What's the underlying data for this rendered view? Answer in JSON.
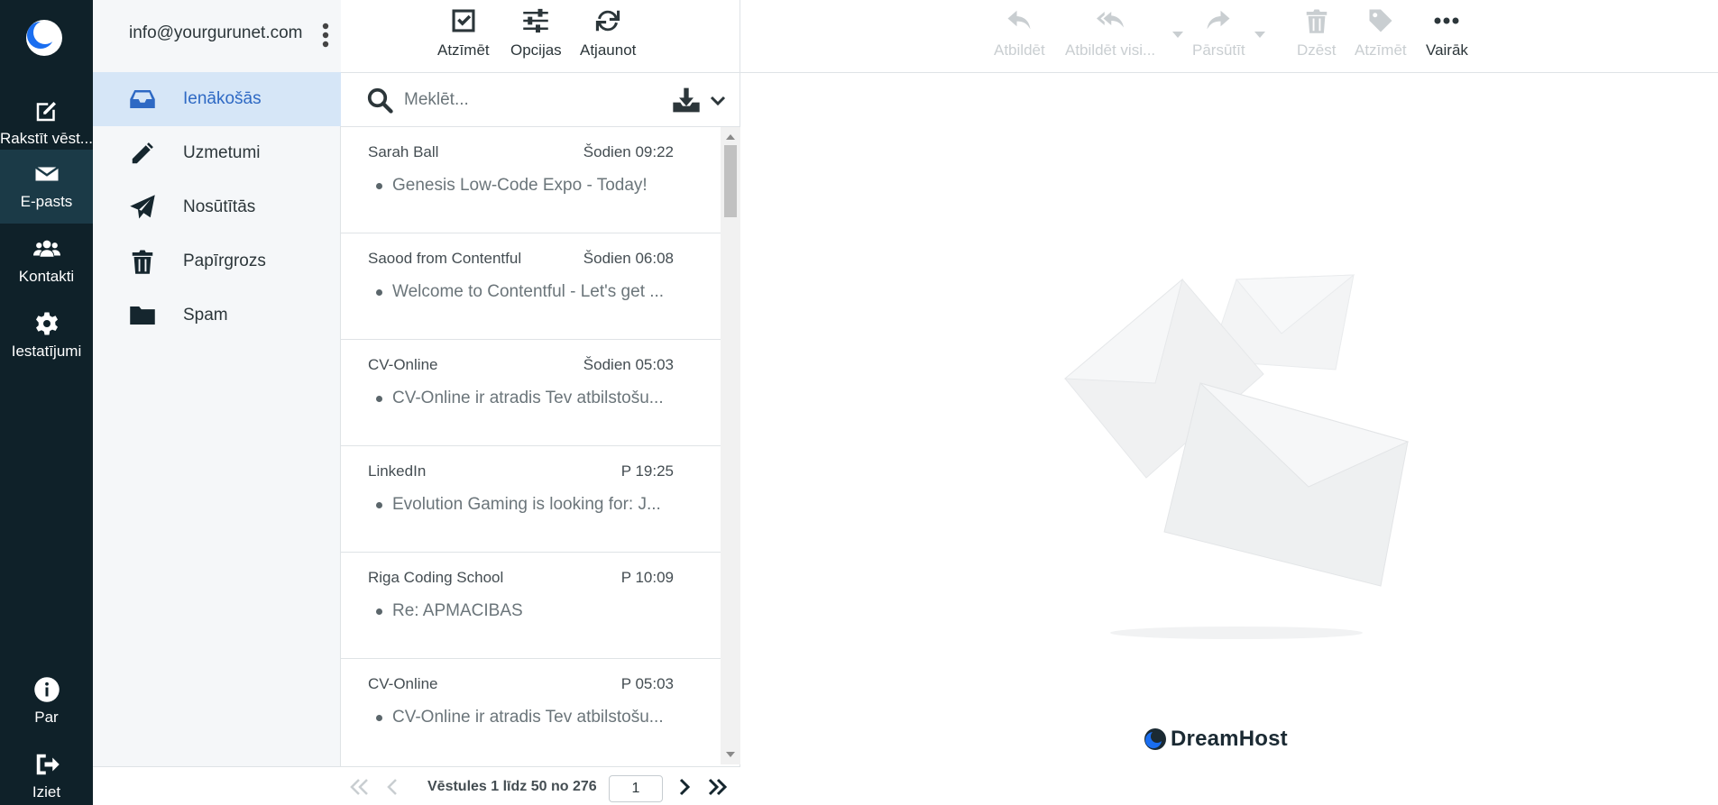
{
  "nav": {
    "items": [
      {
        "label": "Rakstīt vēst...",
        "icon": "compose-icon"
      },
      {
        "label": "E-pasts",
        "icon": "envelope-icon"
      },
      {
        "label": "Kontakti",
        "icon": "contacts-icon"
      },
      {
        "label": "Iestatījumi",
        "icon": "gear-icon"
      }
    ],
    "bottom": [
      {
        "label": "Par",
        "icon": "info-icon"
      },
      {
        "label": "Iziet",
        "icon": "logout-icon"
      }
    ]
  },
  "account": {
    "email": "info@yourgurunet.com"
  },
  "folders": [
    {
      "label": "Ienākošās",
      "icon": "inbox-icon",
      "active": true
    },
    {
      "label": "Uzmetumi",
      "icon": "pencil-icon"
    },
    {
      "label": "Nosūtītās",
      "icon": "send-icon"
    },
    {
      "label": "Papīrgrozs",
      "icon": "trash-icon"
    },
    {
      "label": "Spam",
      "icon": "folder-icon"
    }
  ],
  "list_toolbar": {
    "select": "Atzīmēt",
    "options": "Opcijas",
    "refresh": "Atjaunot"
  },
  "search": {
    "placeholder": "Meklēt..."
  },
  "messages": [
    {
      "from": "Sarah Ball",
      "date": "Šodien 09:22",
      "subject": "Genesis Low-Code Expo - Today!"
    },
    {
      "from": "Saood from Contentful",
      "date": "Šodien 06:08",
      "subject": "Welcome to Contentful - Let's get ..."
    },
    {
      "from": "CV-Online",
      "date": "Šodien 05:03",
      "subject": "CV-Online ir atradis Tev atbilstošu..."
    },
    {
      "from": "LinkedIn",
      "date": "P 19:25",
      "subject": "Evolution Gaming is looking for: J..."
    },
    {
      "from": "Riga Coding School",
      "date": "P 10:09",
      "subject": "Re: APMACIBAS"
    },
    {
      "from": "CV-Online",
      "date": "P 05:03",
      "subject": "CV-Online ir atradis Tev atbilstošu..."
    }
  ],
  "pager": {
    "text": "Vēstules 1 līdz 50 no 276",
    "page": "1"
  },
  "preview_toolbar": {
    "reply": "Atbildēt",
    "reply_all": "Atbildēt visi...",
    "forward": "Pārsūtīt",
    "delete": "Dzēst",
    "mark": "Atzīmēt",
    "more": "Vairāk"
  },
  "brand": {
    "name": "DreamHost"
  },
  "colors": {
    "nav_bg": "#0f2129",
    "accent": "#2e69c4",
    "active_folder_bg": "#d6e6f7"
  }
}
